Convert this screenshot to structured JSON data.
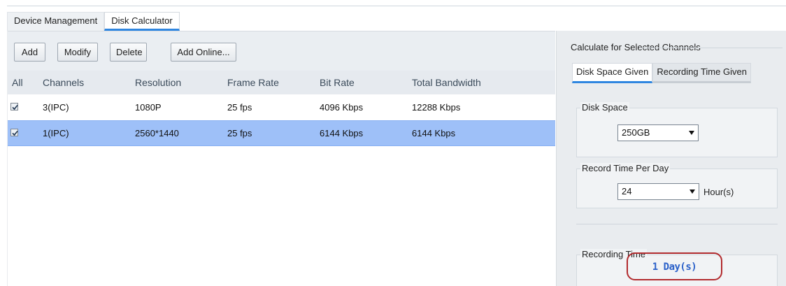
{
  "tabs": [
    {
      "label": "Device Management"
    },
    {
      "label": "Disk Calculator"
    }
  ],
  "toolbar": {
    "add": "Add",
    "modify": "Modify",
    "delete": "Delete",
    "add_online": "Add Online..."
  },
  "list": {
    "columns": [
      "All",
      "Channels",
      "Resolution",
      "Frame Rate",
      "Bit Rate",
      "Total Bandwidth"
    ],
    "rows": [
      {
        "checked": true,
        "selected": false,
        "channel": "3(IPC)",
        "resolution": "1080P",
        "frame_rate": "25 fps",
        "bit_rate": "4096 Kbps",
        "bandwidth": "12288 Kbps"
      },
      {
        "checked": true,
        "selected": true,
        "channel": "1(IPC)",
        "resolution": "2560*1440",
        "frame_rate": "25 fps",
        "bit_rate": "6144 Kbps",
        "bandwidth": "6144 Kbps"
      }
    ]
  },
  "calc": {
    "title": "Calculate for Selected Channels",
    "subtabs": [
      {
        "label": "Disk Space Given"
      },
      {
        "label": "Recording Time Given"
      }
    ],
    "disk_space": {
      "label": "Disk Space",
      "value": "250GB"
    },
    "record_time": {
      "label": "Record Time Per Day",
      "value": "24",
      "unit": "Hour(s)"
    },
    "recording_time": {
      "label": "Recording Time",
      "value": "1 Day(s)"
    }
  },
  "colors": {
    "accent": "#2f86e0",
    "selected_row": "#9ec0f8",
    "highlight_border": "#b22b2e",
    "result_text": "#2a60c9"
  }
}
